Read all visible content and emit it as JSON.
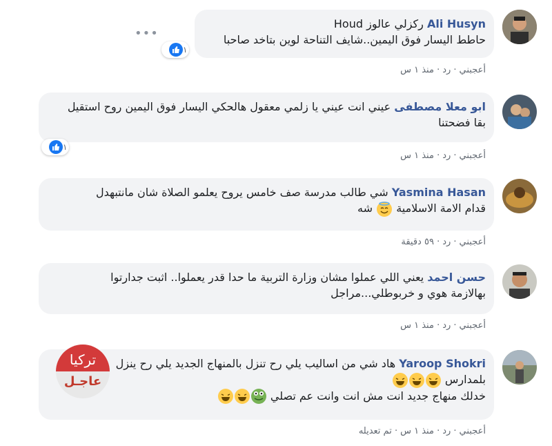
{
  "comments": [
    {
      "name": "Ali Husyn",
      "line1": "ركزلي عالوز Houd",
      "line2": "حاطط اليسار فوق اليمين..شايف التناحة لوين بتاخد صاحبا",
      "like": "أعجبني",
      "reply": "رد",
      "time": "منذ ١ س",
      "reactions": "١"
    },
    {
      "name": "ابو معلا مصطفى",
      "line1": "عيني انت عيني يا زلمي معقول هالحكي اليسار فوق اليمين روح استقيل",
      "line2": "بقا فضحتنا",
      "like": "أعجبني",
      "reply": "رد",
      "time": "منذ ١ س",
      "reactions": "١"
    },
    {
      "name": "Yasmina Hasan",
      "line1": "شي طالب مدرسة صف خامس يروح يعلمو الصلاة شان مانتبهدل",
      "line2": "قدام الامة الاسلامية",
      "line2_end": "شه",
      "like": "أعجبني",
      "reply": "رد",
      "time": "٥٩ دقيقة"
    },
    {
      "name": "حسن احمد",
      "line1": "يعني اللي عملوا مشان وزارة التربية ما حدا قدر يعملوا.. اثبت جدارتوا",
      "line2": "بهالازمة هوي و خربوطلي...مراجل",
      "like": "أعجبني",
      "reply": "رد",
      "time": "منذ ١ س"
    },
    {
      "name": "Yaroop Shokri",
      "line1": "هاد شي من اساليب يلي رح تنزل بالمنهاج الجديد يلي رح ينزل",
      "line2": "بلمدارس",
      "line3": "خدلك منهاج جديد انت مش انت وانت عم تصلي",
      "like": "أعجبني",
      "reply": "رد",
      "time": "منذ ١ س",
      "edited": "تم تعديله"
    }
  ],
  "watermark": {
    "top": "تركيا",
    "bottom": "عاجـل"
  },
  "colors": {
    "link": "#385898",
    "bubble": "#f2f3f5",
    "like": "#1877f2",
    "meta": "#606770"
  }
}
